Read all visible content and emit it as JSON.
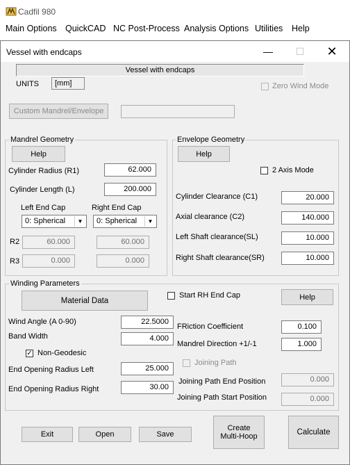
{
  "app": {
    "title": "Cadfil  980"
  },
  "menu": [
    "Main Options",
    "QuickCAD",
    "NC Post-Process",
    "Analysis Options",
    "Utilities",
    "Help"
  ],
  "dialog": {
    "title": "Vessel with endcaps",
    "header_field": "Vessel with endcaps",
    "units_label": "UNITS",
    "units_value": "[mm]",
    "zero_wind_mode": "Zero Wind Mode",
    "custom_button": "Custom Mandrel/Envelope"
  },
  "mandrel": {
    "group": "Mandrel Geometry",
    "help": "Help",
    "cyl_radius_label": "Cylinder Radius (R1)",
    "cyl_radius": "62.000",
    "cyl_length_label": "Cylinder Length (L)",
    "cyl_length": "200.000",
    "left_cap_label": "Left End Cap",
    "right_cap_label": "Right End Cap",
    "left_cap": "0: Spherical",
    "right_cap": "0: Spherical",
    "r2_label": "R2",
    "r3_label": "R3",
    "r2_left": "60.000",
    "r2_right": "60.000",
    "r3_left": "0.000",
    "r3_right": "0.000"
  },
  "envelope": {
    "group": "Envelope Geometry",
    "help": "Help",
    "two_axis": "2 Axis Mode",
    "c1_label": "Cylinder Clearance (C1)",
    "c1": "20.000",
    "c2_label": "Axial clearance (C2)",
    "c2": "140.000",
    "sl_label": "Left Shaft clearance(SL)",
    "sl": "10.000",
    "sr_label": "Right Shaft clearance(SR)",
    "sr": "10.000"
  },
  "winding": {
    "group": "Winding Parameters",
    "material_button": "Material Data",
    "start_rh": "Start RH End Cap",
    "help": "Help",
    "wind_angle_label": "Wind Angle (A 0-90)",
    "wind_angle": "22.5000",
    "band_width_label": "Band Width",
    "band_width": "4.000",
    "non_geodesic": "Non-Geodesic",
    "friction_label": "FRiction Coefficient",
    "friction": "0.100",
    "mandrel_dir_label": "Mandrel Direction +1/-1",
    "mandrel_dir": "1.000",
    "joining_path": "Joining Path",
    "eor_left_label": "End Opening Radius Left",
    "eor_left": "25.000",
    "eor_right_label": "End Opening Radius Right",
    "eor_right": "30.00",
    "jp_end_label": "Joining Path End Position",
    "jp_end": "0.000",
    "jp_start_label": "Joining Path Start Position",
    "jp_start": "0.000"
  },
  "buttons": {
    "exit": "Exit",
    "open": "Open",
    "save": "Save",
    "create_line1": "Create",
    "create_line2": "Multi-Hoop",
    "calculate": "Calculate"
  }
}
